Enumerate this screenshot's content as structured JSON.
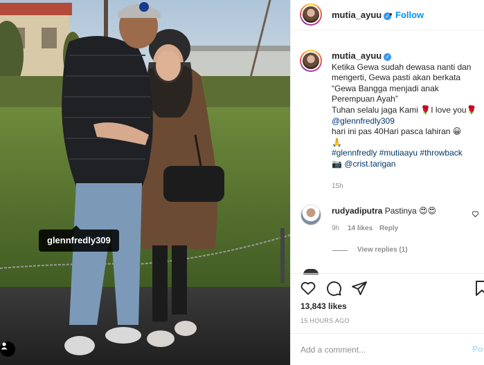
{
  "photo": {
    "tag_label": "glennfredly309",
    "user_tag_icon": "person-icon"
  },
  "header": {
    "username": "mutia_ayuu",
    "verified_icon": "check-icon",
    "separator": "•",
    "follow_label": "Follow"
  },
  "caption": {
    "username": "mutia_ayuu",
    "lines": [
      "Ketika Gewa sudah dewasa nanti dan",
      "mengerti, Gewa pasti akan berkata",
      "“Gewa Bangga menjadi anak",
      "Perempuan Ayah”",
      "Tuhan selalu jaga Kami 🌹I love you🌹",
      "@glennfredly309",
      "hari ini pas 40Hari pasca lahiran 😀",
      "🙏",
      "#glennfredly #mutiaayu #throwback",
      "📷 @crist.tarigan"
    ],
    "time": "15h"
  },
  "comment": {
    "username": "rudyadiputra",
    "text": "Pastinya 😍😍",
    "time": "9h",
    "likes": "14 likes",
    "reply_label": "Reply",
    "view_replies": "View replies (1)"
  },
  "actions": {
    "like_icon": "heart-icon",
    "comment_icon": "comment-icon",
    "share_icon": "share-icon",
    "save_icon": "bookmark-icon"
  },
  "likes_count": "13,843 likes",
  "date": "15 HOURS AGO",
  "add_comment": {
    "placeholder": "Add a comment...",
    "post_label": "Post"
  },
  "colors": {
    "accent": "#0095f6",
    "link": "#00376b",
    "muted": "#8e8e8e",
    "post_disabled": "#b2dffc"
  }
}
